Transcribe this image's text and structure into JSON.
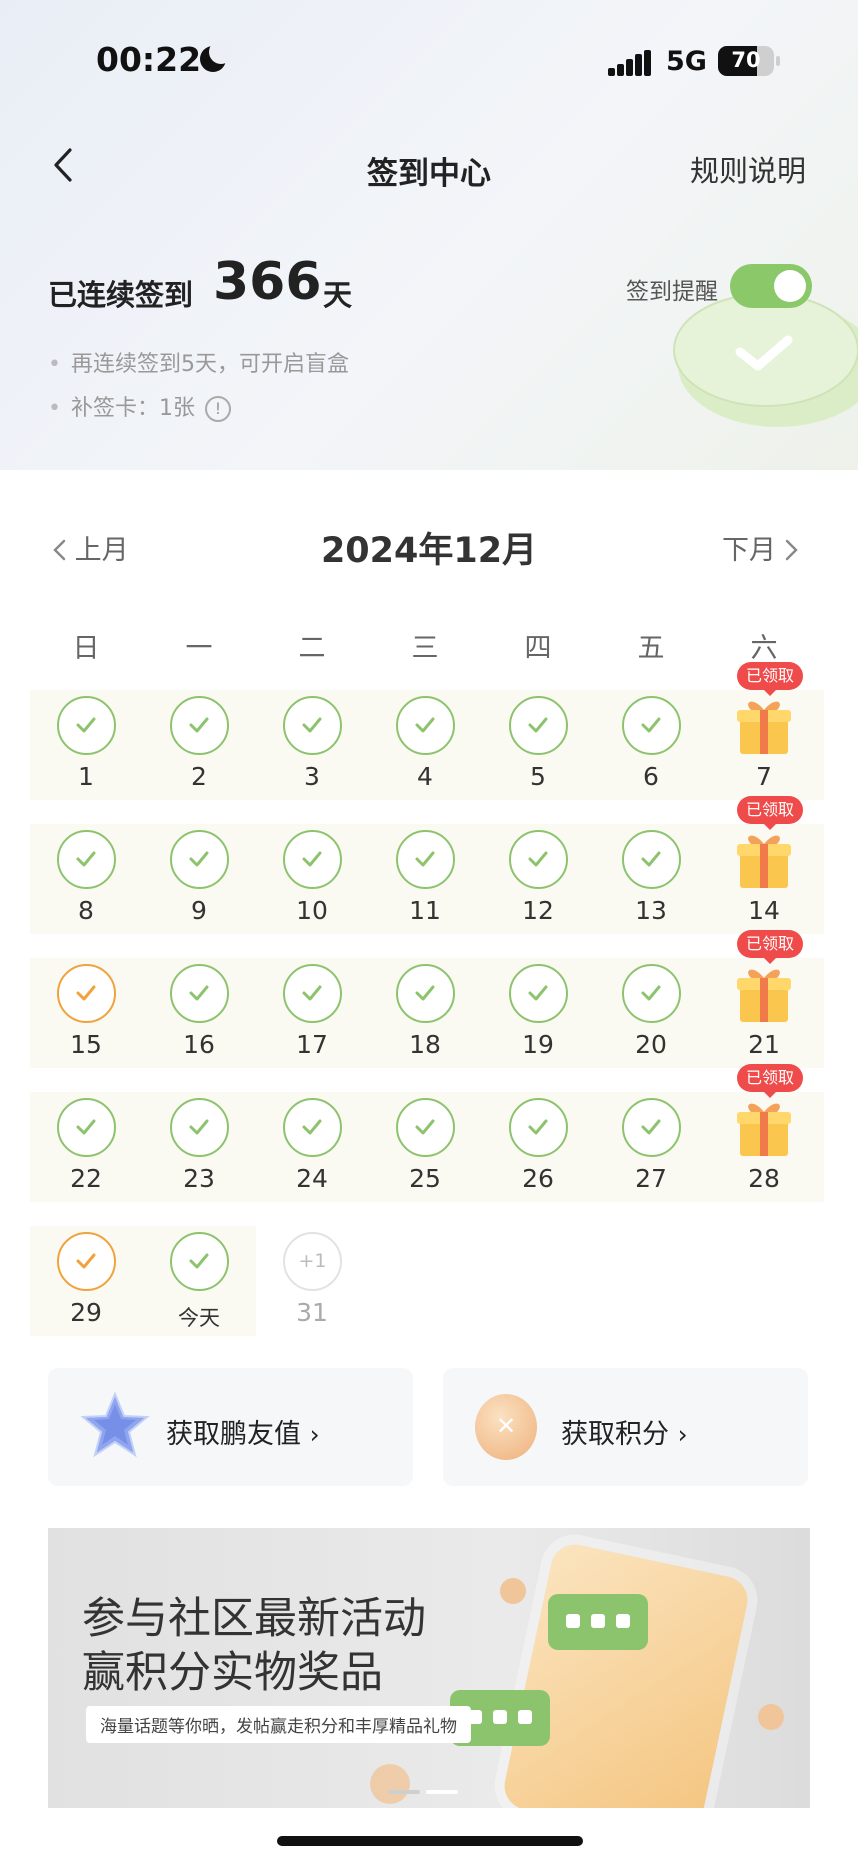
{
  "status_bar": {
    "time": "00:22",
    "network": "5G",
    "battery": "70",
    "battery_level": 0.7
  },
  "nav": {
    "title": "签到中心",
    "rules_label": "规则说明"
  },
  "streak": {
    "label": "已连续签到",
    "days": "366",
    "unit": "天",
    "reminder_label": "签到提醒",
    "reminder_on": true
  },
  "tips": {
    "blind_box": "再连续签到5天，可开启盲盒",
    "makeup_card": "补签卡：1张"
  },
  "calendar": {
    "month_title": "2024年12月",
    "prev_label": "上月",
    "next_label": "下月",
    "weekdays": [
      "日",
      "一",
      "二",
      "三",
      "四",
      "五",
      "六"
    ],
    "claimed_label": "已领取",
    "days": [
      {
        "label": "1",
        "state": "signed"
      },
      {
        "label": "2",
        "state": "signed"
      },
      {
        "label": "3",
        "state": "signed"
      },
      {
        "label": "4",
        "state": "signed"
      },
      {
        "label": "5",
        "state": "signed"
      },
      {
        "label": "6",
        "state": "signed"
      },
      {
        "label": "7",
        "state": "gift"
      },
      {
        "label": "8",
        "state": "signed"
      },
      {
        "label": "9",
        "state": "signed"
      },
      {
        "label": "10",
        "state": "signed"
      },
      {
        "label": "11",
        "state": "signed"
      },
      {
        "label": "12",
        "state": "signed"
      },
      {
        "label": "13",
        "state": "signed"
      },
      {
        "label": "14",
        "state": "gift"
      },
      {
        "label": "15",
        "state": "makeup"
      },
      {
        "label": "16",
        "state": "signed"
      },
      {
        "label": "17",
        "state": "signed"
      },
      {
        "label": "18",
        "state": "signed"
      },
      {
        "label": "19",
        "state": "signed"
      },
      {
        "label": "20",
        "state": "signed"
      },
      {
        "label": "21",
        "state": "gift"
      },
      {
        "label": "22",
        "state": "signed"
      },
      {
        "label": "23",
        "state": "signed"
      },
      {
        "label": "24",
        "state": "signed"
      },
      {
        "label": "25",
        "state": "signed"
      },
      {
        "label": "26",
        "state": "signed"
      },
      {
        "label": "27",
        "state": "signed"
      },
      {
        "label": "28",
        "state": "gift"
      },
      {
        "label": "29",
        "state": "makeup"
      },
      {
        "label": "今天",
        "state": "signed-today"
      },
      {
        "label": "31",
        "state": "future",
        "bonus": "+1"
      }
    ]
  },
  "actions": {
    "friend_value_label": "获取鹏友值",
    "points_label": "获取积分"
  },
  "banner": {
    "line1": "参与社区最新活动",
    "line2": "赢积分实物奖品",
    "subtitle": "海量话题等你晒，发帖赢走积分和丰厚精品礼物"
  },
  "colors": {
    "signed": "#8ec36e",
    "makeup": "#f0a23c",
    "claimed_badge": "#f04b4b",
    "toggle_on": "#8bc86a"
  }
}
